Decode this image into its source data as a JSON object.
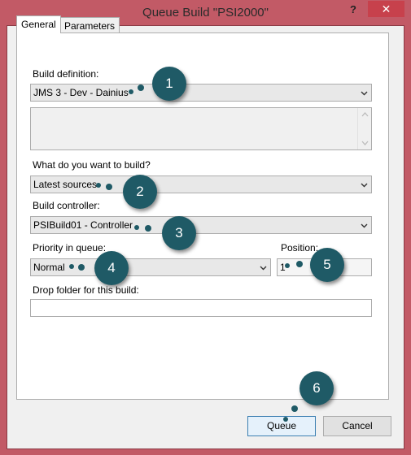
{
  "window": {
    "title": "Queue Build \"PSI2000\"",
    "help_label": "?",
    "close_label": "✕"
  },
  "tabs": [
    {
      "label": "General"
    },
    {
      "label": "Parameters"
    }
  ],
  "form": {
    "build_definition_label": "Build definition:",
    "build_definition_value": "JMS 3 - Dev - Dainius",
    "description_value": "",
    "what_to_build_label": "What do you want to build?",
    "what_to_build_value": "Latest sources",
    "build_controller_label": "Build controller:",
    "build_controller_value": "PSIBuild01 - Controller",
    "priority_label": "Priority in queue:",
    "priority_value": "Normal",
    "position_label": "Position:",
    "position_value": "1",
    "drop_folder_label": "Drop folder for this build:",
    "drop_folder_value": ""
  },
  "buttons": {
    "queue_label": "Queue",
    "cancel_label": "Cancel"
  },
  "callouts": [
    "1",
    "2",
    "3",
    "4",
    "5",
    "6"
  ],
  "colors": {
    "window_border": "#c25a66",
    "callout": "#1f5a66",
    "close_button": "#c7414c"
  }
}
